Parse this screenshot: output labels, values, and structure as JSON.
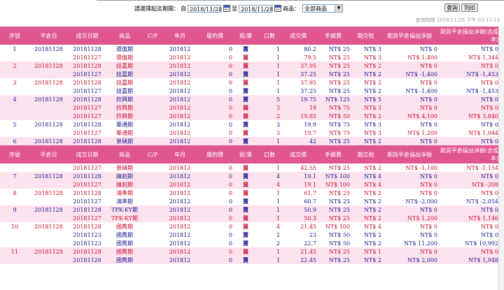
{
  "filter": {
    "period_label": "請選擇起迄期間：",
    "start_label": "自",
    "start_date": "2018/11/28",
    "end_label": "至",
    "end_date": "2018/11/28",
    "product_label": "商品：",
    "product_value": "全部商品",
    "query_button": "查詢",
    "print_button": "列印"
  },
  "query_time": "查詢時間 2018/11/28 下午 03:15:13",
  "headers": [
    "序號",
    "平倉日",
    "成交日期",
    "商品",
    "C/P",
    "年月",
    "履約價",
    "買/賣",
    "口數",
    "成交價",
    "手續費",
    "期交稅",
    "期貨平倉損益淨額",
    "期貨平倉損益淨額(含成本)"
  ],
  "colors": {
    "header_bg": "#e0568e",
    "pink_row": "#fde3ef",
    "navy_text": "#1a1a8c",
    "red_text": "#c8102e"
  },
  "groups": [
    {
      "rows": [
        {
          "seq": "1",
          "close_date": "20181128",
          "trade_date": "20181128",
          "product": "環億期",
          "cp": "",
          "ym": "201812",
          "strike": "0",
          "side": "賣",
          "qty": "1",
          "price": "80.2",
          "fee": "NT$ 25",
          "tax": "NT$ 3",
          "pnl": "NT$ 0",
          "pnl_cost": "NT$ 0",
          "color": "navy"
        },
        {
          "seq": "",
          "close_date": "",
          "trade_date": "20181127",
          "product": "環億期",
          "cp": "",
          "ym": "201812",
          "strike": "0",
          "side": "買",
          "qty": "1",
          "price": "79.5",
          "fee": "NT$ 25",
          "tax": "NT$ 3",
          "pnl": "NT$ 1,400",
          "pnl_cost": "NT$ 1,344",
          "color": "red"
        }
      ]
    },
    {
      "rows": [
        {
          "seq": "2",
          "close_date": "20181128",
          "trade_date": "20181128",
          "product": "技嘉期",
          "cp": "",
          "ym": "201812",
          "strike": "0",
          "side": "買",
          "qty": "1",
          "price": "37.95",
          "fee": "NT$ 25",
          "tax": "NT$ 2",
          "pnl": "NT$ 0",
          "pnl_cost": "NT$ 0",
          "color": "red"
        },
        {
          "seq": "",
          "close_date": "",
          "trade_date": "20181127",
          "product": "技嘉期",
          "cp": "",
          "ym": "201812",
          "strike": "0",
          "side": "賣",
          "qty": "1",
          "price": "37.25",
          "fee": "NT$ 25",
          "tax": "NT$ 2",
          "pnl": "NT$ -1,400",
          "pnl_cost": "NT$ -1,453",
          "color": "navy"
        }
      ]
    },
    {
      "rows": [
        {
          "seq": "3",
          "close_date": "20181128",
          "trade_date": "20181128",
          "product": "技嘉期",
          "cp": "",
          "ym": "201812",
          "strike": "0",
          "side": "買",
          "qty": "1",
          "price": "37.95",
          "fee": "NT$ 25",
          "tax": "NT$ 2",
          "pnl": "NT$ 0",
          "pnl_cost": "NT$ 0",
          "color": "red"
        },
        {
          "seq": "",
          "close_date": "",
          "trade_date": "20181127",
          "product": "技嘉期",
          "cp": "",
          "ym": "201812",
          "strike": "0",
          "side": "賣",
          "qty": "1",
          "price": "37.25",
          "fee": "NT$ 25",
          "tax": "NT$ 2",
          "pnl": "NT$ -1,400",
          "pnl_cost": "NT$ -1,453",
          "color": "navy"
        }
      ]
    },
    {
      "rows": [
        {
          "seq": "4",
          "close_date": "20181128",
          "trade_date": "20181128",
          "product": "欣興期",
          "cp": "",
          "ym": "201812",
          "strike": "0",
          "side": "賣",
          "qty": "5",
          "price": "19.75",
          "fee": "NT$ 125",
          "tax": "NT$ 5",
          "pnl": "NT$ 0",
          "pnl_cost": "NT$ 0",
          "color": "navy"
        },
        {
          "seq": "",
          "close_date": "",
          "trade_date": "20181127",
          "product": "欣興期",
          "cp": "",
          "ym": "201812",
          "strike": "0",
          "side": "買",
          "qty": "3",
          "price": "19",
          "fee": "NT$ 75",
          "tax": "NT$ 3",
          "pnl": "NT$ 0",
          "pnl_cost": "NT$ 0",
          "color": "red"
        },
        {
          "seq": "",
          "close_date": "",
          "trade_date": "20181127",
          "product": "欣興期",
          "cp": "",
          "ym": "201812",
          "strike": "0",
          "side": "買",
          "qty": "2",
          "price": "19.85",
          "fee": "NT$ 50",
          "tax": "NT$ 2",
          "pnl": "NT$ 4,100",
          "pnl_cost": "NT$ 3,840",
          "color": "red"
        }
      ]
    },
    {
      "rows": [
        {
          "seq": "5",
          "close_date": "20181128",
          "trade_date": "20181128",
          "product": "華通期",
          "cp": "",
          "ym": "201812",
          "strike": "0",
          "side": "賣",
          "qty": "3",
          "price": "19.9",
          "fee": "NT$ 75",
          "tax": "NT$ 3",
          "pnl": "NT$ 0",
          "pnl_cost": "NT$ 0",
          "color": "navy"
        },
        {
          "seq": "",
          "close_date": "",
          "trade_date": "20181127",
          "product": "華通期",
          "cp": "",
          "ym": "201812",
          "strike": "0",
          "side": "買",
          "qty": "3",
          "price": "19.7",
          "fee": "NT$ 75",
          "tax": "NT$ 3",
          "pnl": "NT$ 1,200",
          "pnl_cost": "NT$ 1,044",
          "color": "red"
        }
      ]
    },
    {
      "rows": [
        {
          "seq": "6",
          "close_date": "20181128",
          "trade_date": "20181128",
          "product": "景碩期",
          "cp": "",
          "ym": "201812",
          "strike": "0",
          "side": "賣",
          "qty": "1",
          "price": "42",
          "fee": "NT$ 25",
          "tax": "NT$ 2",
          "pnl": "NT$ 0",
          "pnl_cost": "NT$ 0",
          "color": "navy"
        }
      ]
    },
    {
      "header": true
    },
    {
      "rows": [
        {
          "seq": "",
          "close_date": "",
          "trade_date": "20181127",
          "product": "景碩期",
          "cp": "",
          "ym": "201812",
          "strike": "0",
          "side": "買",
          "qty": "1",
          "price": "42.55",
          "fee": "NT$ 25",
          "tax": "NT$ 2",
          "pnl": "NT$ -1,100",
          "pnl_cost": "NT$ -1,154",
          "color": "red"
        }
      ]
    },
    {
      "rows": [
        {
          "seq": "7",
          "close_date": "20181128",
          "trade_date": "20181128",
          "product": "緯創期",
          "cp": "",
          "ym": "201812",
          "strike": "0",
          "side": "賣",
          "qty": "4",
          "price": "19.1",
          "fee": "NT$ 100",
          "tax": "NT$ 4",
          "pnl": "NT$ 0",
          "pnl_cost": "NT$ 0",
          "color": "navy"
        },
        {
          "seq": "",
          "close_date": "",
          "trade_date": "20181127",
          "product": "緯創期",
          "cp": "",
          "ym": "201812",
          "strike": "0",
          "side": "買",
          "qty": "4",
          "price": "19.1",
          "fee": "NT$ 100",
          "tax": "NT$ 4",
          "pnl": "NT$ 0",
          "pnl_cost": "NT$ -208",
          "color": "red"
        }
      ]
    },
    {
      "rows": [
        {
          "seq": "8",
          "close_date": "20181128",
          "trade_date": "20181128",
          "product": "鴻準期",
          "cp": "",
          "ym": "201812",
          "strike": "0",
          "side": "買",
          "qty": "1",
          "price": "61.7",
          "fee": "NT$ 25",
          "tax": "NT$ 2",
          "pnl": "NT$ 0",
          "pnl_cost": "NT$ 0",
          "color": "red"
        },
        {
          "seq": "",
          "close_date": "",
          "trade_date": "20181127",
          "product": "鴻準期",
          "cp": "",
          "ym": "201812",
          "strike": "0",
          "side": "賣",
          "qty": "1",
          "price": "60.7",
          "fee": "NT$ 25",
          "tax": "NT$ 2",
          "pnl": "NT$ -2,000",
          "pnl_cost": "NT$ -2,054",
          "color": "navy"
        }
      ]
    },
    {
      "rows": [
        {
          "seq": "9",
          "close_date": "20181128",
          "trade_date": "20181128",
          "product": "TPK-KY期",
          "cp": "",
          "ym": "201812",
          "strike": "0",
          "side": "賣",
          "qty": "1",
          "price": "50.9",
          "fee": "NT$ 25",
          "tax": "NT$ 2",
          "pnl": "NT$ 0",
          "pnl_cost": "NT$ 0",
          "color": "navy"
        },
        {
          "seq": "",
          "close_date": "",
          "trade_date": "20181127",
          "product": "TPK-KY期",
          "cp": "",
          "ym": "201812",
          "strike": "0",
          "side": "買",
          "qty": "1",
          "price": "50.3",
          "fee": "NT$ 25",
          "tax": "NT$ 2",
          "pnl": "NT$ 1,200",
          "pnl_cost": "NT$ 1,146",
          "color": "red"
        }
      ]
    },
    {
      "rows": [
        {
          "seq": "10",
          "close_date": "20181128",
          "trade_date": "20181128",
          "product": "國喬期",
          "cp": "",
          "ym": "201812",
          "strike": "0",
          "side": "買",
          "qty": "4",
          "price": "21.45",
          "fee": "NT$ 100",
          "tax": "NT$ 4",
          "pnl": "NT$ 0",
          "pnl_cost": "NT$ 0",
          "color": "red"
        },
        {
          "seq": "",
          "close_date": "",
          "trade_date": "20181123",
          "product": "國喬期",
          "cp": "",
          "ym": "201812",
          "strike": "0",
          "side": "賣",
          "qty": "2",
          "price": "23",
          "fee": "NT$ 50",
          "tax": "NT$ 2",
          "pnl": "NT$ 0",
          "pnl_cost": "NT$ 0",
          "color": "navy"
        },
        {
          "seq": "",
          "close_date": "",
          "trade_date": "20181123",
          "product": "國喬期",
          "cp": "",
          "ym": "201812",
          "strike": "0",
          "side": "賣",
          "qty": "2",
          "price": "22.7",
          "fee": "NT$ 50",
          "tax": "NT$ 2",
          "pnl": "NT$ 11,200",
          "pnl_cost": "NT$ 10,992",
          "color": "navy"
        }
      ]
    },
    {
      "rows": [
        {
          "seq": "11",
          "close_date": "20181128",
          "trade_date": "20181128",
          "product": "國喬期",
          "cp": "",
          "ym": "201812",
          "strike": "0",
          "side": "買",
          "qty": "1",
          "price": "21.45",
          "fee": "NT$ 25",
          "tax": "NT$ 1",
          "pnl": "NT$ 0",
          "pnl_cost": "NT$ 0",
          "color": "red"
        },
        {
          "seq": "",
          "close_date": "",
          "trade_date": "20181126",
          "product": "國喬期",
          "cp": "",
          "ym": "201812",
          "strike": "0",
          "side": "賣",
          "qty": "1",
          "price": "22.45",
          "fee": "NT$ 25",
          "tax": "NT$ 2",
          "pnl": "NT$ 2,000",
          "pnl_cost": "NT$ 1,948",
          "color": "navy"
        }
      ]
    }
  ]
}
